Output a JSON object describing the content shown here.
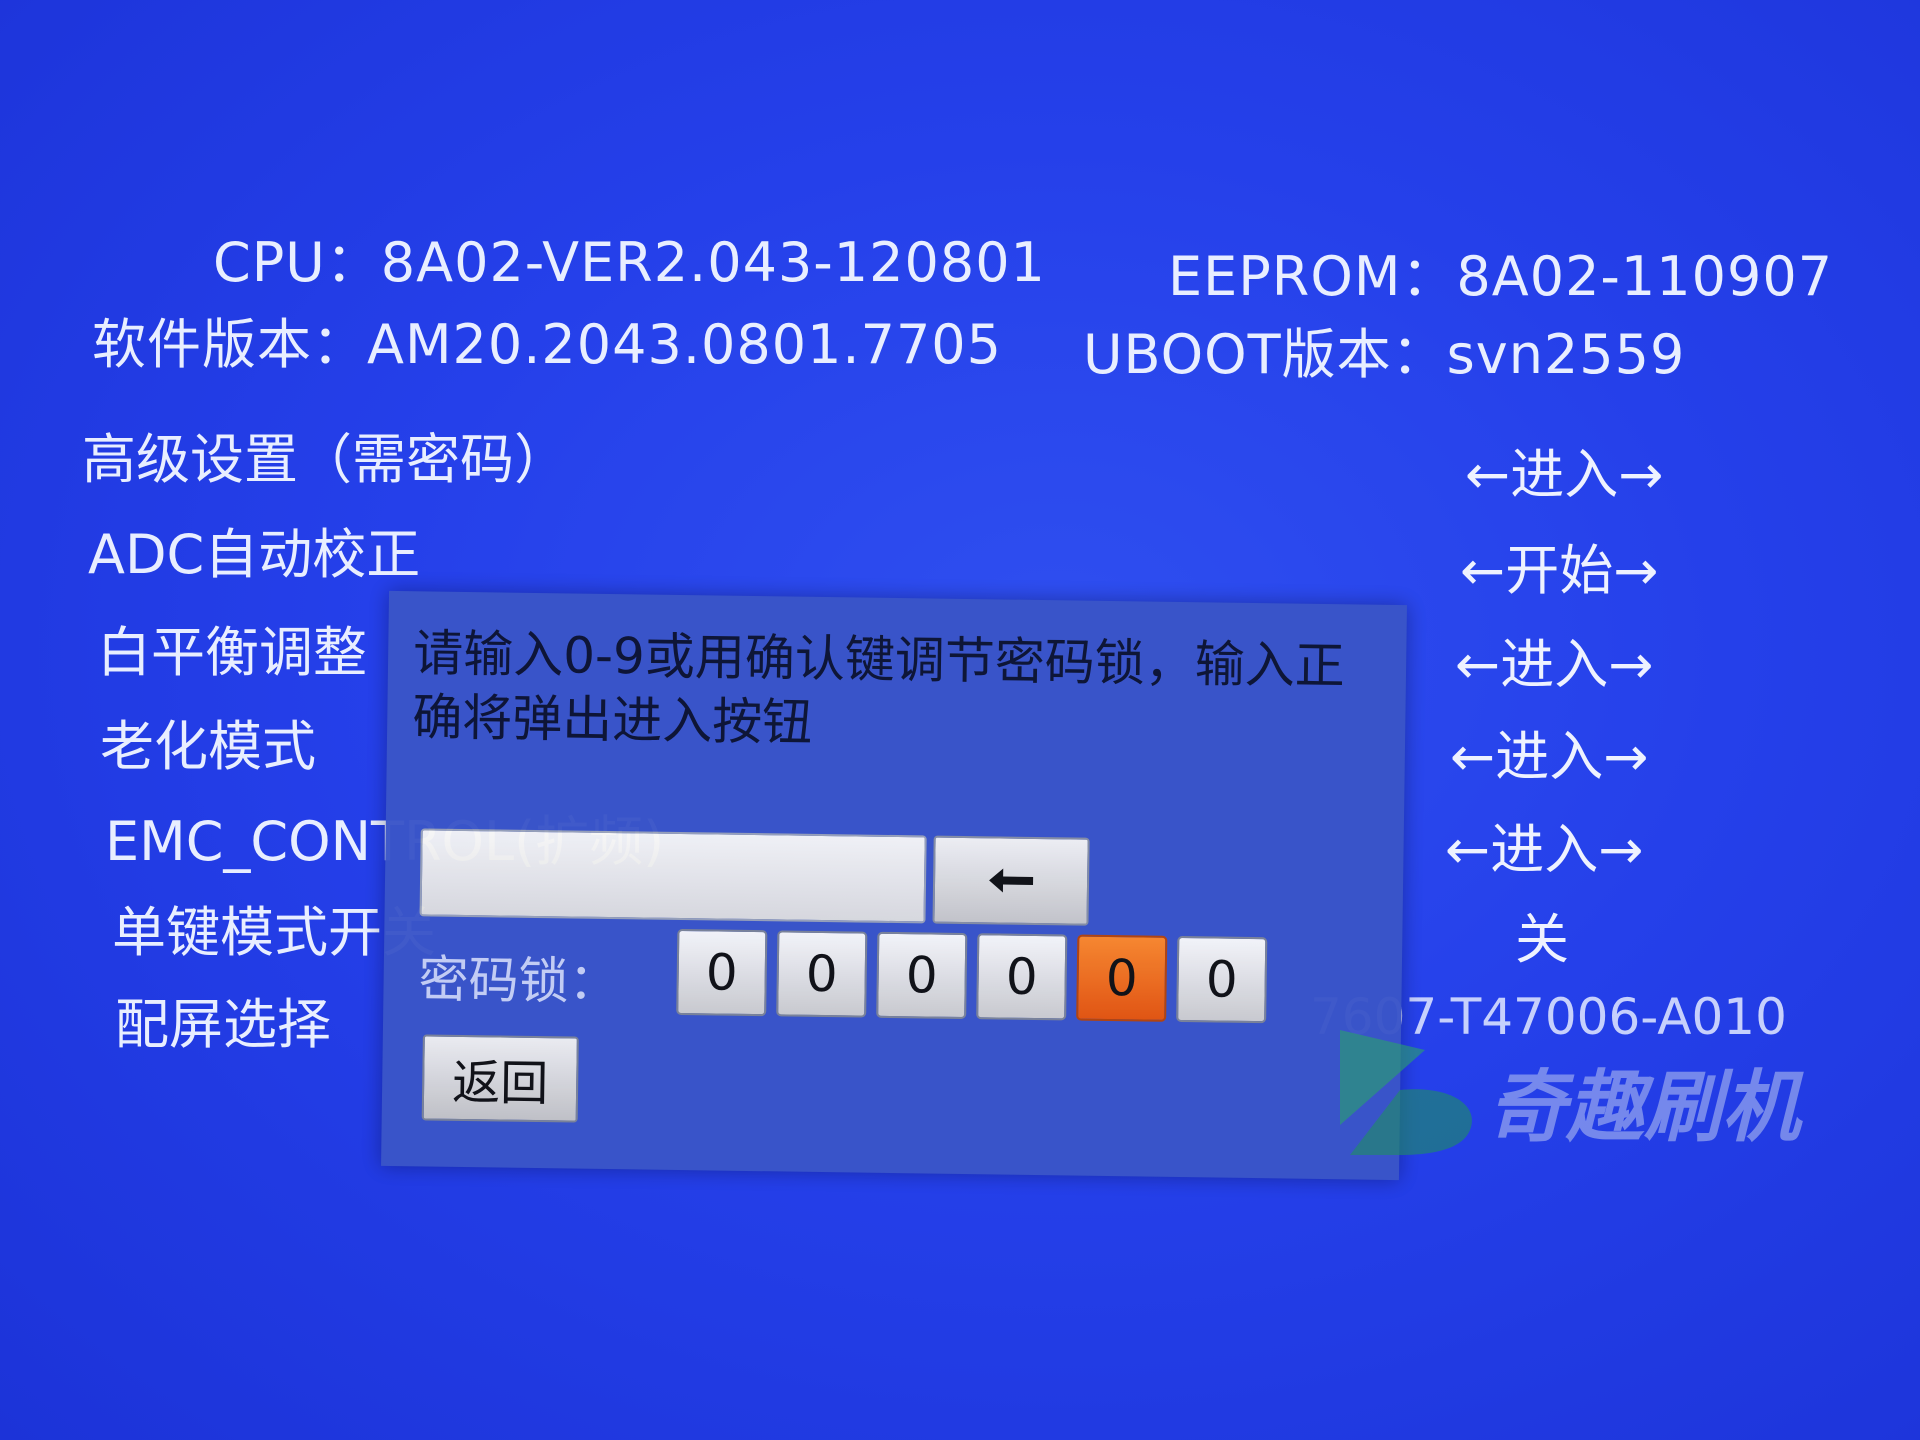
{
  "info": {
    "cpu": "CPU：8A02-VER2.043-120801",
    "eeprom": "EEPROM：8A02-110907",
    "software": "软件版本：AM20.2043.0801.7705",
    "uboot": "UBOOT版本：svn2559"
  },
  "menu": [
    {
      "label": "高级设置（需密码）",
      "value": "←进入→"
    },
    {
      "label": "ADC自动校正",
      "value": "←开始→"
    },
    {
      "label": "白平衡调整",
      "value": "←进入→"
    },
    {
      "label": "老化模式",
      "value": "←进入→"
    },
    {
      "label": "EMC_CONTROL(扩频)",
      "value": "←进入→"
    },
    {
      "label": "单键模式开关",
      "value": "关"
    },
    {
      "label": "配屏选择",
      "value": "7607-T47006-A010"
    }
  ],
  "dialog": {
    "message": "请输入0-9或用确认键调节密码锁，输入正确将弹出进入按钮",
    "input_value": "",
    "backspace_icon": "arrow-left-icon",
    "lock_label": "密码锁：",
    "digits": [
      "0",
      "0",
      "0",
      "0",
      "0",
      "0"
    ],
    "active_digit_index": 4,
    "return_label": "返回"
  },
  "watermark": {
    "text": "奇趣刷机",
    "logo_icon": "b-logo-icon"
  },
  "colors": {
    "background": "#2540ea",
    "dialog": "#3a55c8",
    "active_digit": "#f26a12",
    "watermark_green": "#2aa36b"
  }
}
